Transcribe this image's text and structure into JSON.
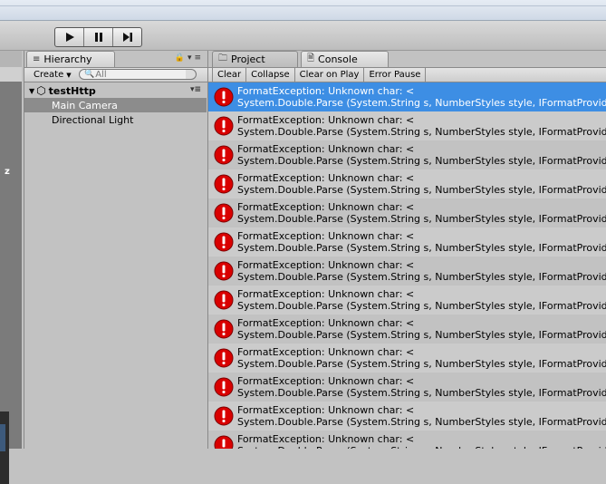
{
  "toolbar": {
    "play_icon": "play-icon",
    "pause_icon": "pause-icon",
    "step_icon": "step-icon"
  },
  "scene": {
    "axis_label": "z"
  },
  "hierarchy": {
    "tab_label": "Hierarchy",
    "create_label": "Create",
    "search_placeholder": "All",
    "root": "testHttp",
    "items": [
      {
        "label": "Main Camera",
        "selected": true
      },
      {
        "label": "Directional Light",
        "selected": false
      }
    ]
  },
  "console": {
    "project_tab": "Project",
    "console_tab": "Console",
    "buttons": [
      "Clear",
      "Collapse",
      "Clear on Play",
      "Error Pause"
    ],
    "entries": [
      {
        "line1": "FormatException: Unknown char: <",
        "line2": "System.Double.Parse (System.String s, NumberStyles style, IFormatProvider provider)"
      },
      {
        "line1": "FormatException: Unknown char: <",
        "line2": "System.Double.Parse (System.String s, NumberStyles style, IFormatProvider provider)"
      },
      {
        "line1": "FormatException: Unknown char: <",
        "line2": "System.Double.Parse (System.String s, NumberStyles style, IFormatProvider provider)"
      },
      {
        "line1": "FormatException: Unknown char: <",
        "line2": "System.Double.Parse (System.String s, NumberStyles style, IFormatProvider provider)"
      },
      {
        "line1": "FormatException: Unknown char: <",
        "line2": "System.Double.Parse (System.String s, NumberStyles style, IFormatProvider provider)"
      },
      {
        "line1": "FormatException: Unknown char: <",
        "line2": "System.Double.Parse (System.String s, NumberStyles style, IFormatProvider provider)"
      },
      {
        "line1": "FormatException: Unknown char: <",
        "line2": "System.Double.Parse (System.String s, NumberStyles style, IFormatProvider provider)"
      },
      {
        "line1": "FormatException: Unknown char: <",
        "line2": "System.Double.Parse (System.String s, NumberStyles style, IFormatProvider provider)"
      },
      {
        "line1": "FormatException: Unknown char: <",
        "line2": "System.Double.Parse (System.String s, NumberStyles style, IFormatProvider provider)"
      },
      {
        "line1": "FormatException: Unknown char: <",
        "line2": "System.Double.Parse (System.String s, NumberStyles style, IFormatProvider provider)"
      },
      {
        "line1": "FormatException: Unknown char: <",
        "line2": "System.Double.Parse (System.String s, NumberStyles style, IFormatProvider provider)"
      },
      {
        "line1": "FormatException: Unknown char: <",
        "line2": "System.Double.Parse (System.String s, NumberStyles style, IFormatProvider provider)"
      },
      {
        "line1": "FormatException: Unknown char: <",
        "line2": "System.Double.Parse (System.String s, NumberStyles style, IFormatProvider provider)"
      }
    ],
    "entry_icon": "error-icon",
    "selected_index": 0
  },
  "colors": {
    "selection": "#3d8ee4",
    "error": "#d90000"
  }
}
